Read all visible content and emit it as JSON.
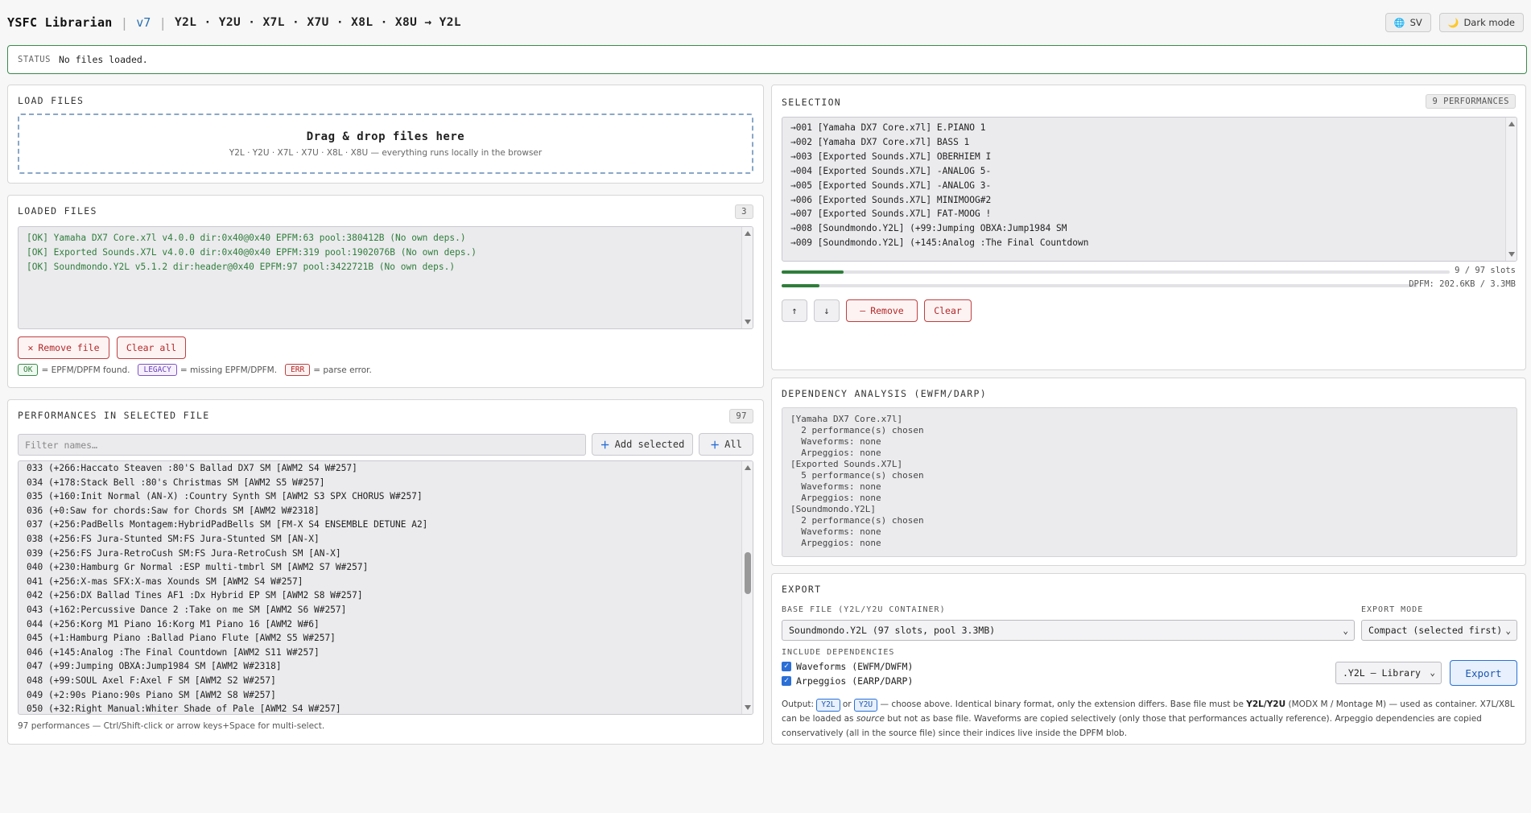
{
  "header": {
    "app_title": "YSFC Librarian",
    "version": "v7",
    "formats": "Y2L · Y2U · X7L · X7U · X8L · X8U → Y2L",
    "lang_label": "SV",
    "theme_label": "Dark mode",
    "lang_icon": "globe-icon",
    "theme_icon": "moon-icon"
  },
  "status": {
    "label": "STATUS",
    "text": "No files loaded."
  },
  "load_files": {
    "title": "LOAD FILES",
    "drop_title": "Drag & drop files here",
    "drop_sub": "Y2L · Y2U · X7L · X7U · X8L · X8U — everything runs locally in the browser"
  },
  "loaded_files": {
    "title": "LOADED FILES",
    "count": "3",
    "lines": [
      "[OK] Yamaha DX7 Core.x7l v4.0.0 dir:0x40@0x40 EPFM:63 pool:380412B (No own deps.)",
      "[OK] Exported Sounds.X7L v4.0.0 dir:0x40@0x40 EPFM:319 pool:1902076B (No own deps.)",
      "[OK] Soundmondo.Y2L v5.1.2 dir:header@0x40 EPFM:97 pool:3422721B (No own deps.)"
    ],
    "remove_label": "Remove file",
    "clear_label": "Clear all",
    "legend": {
      "ok_tag": "OK",
      "ok_text": "= EPFM/DPFM found.",
      "legacy_tag": "LEGACY",
      "legacy_text": "= missing EPFM/DPFM.",
      "err_tag": "ERR",
      "err_text": "= parse error."
    }
  },
  "performances": {
    "title": "PERFORMANCES IN SELECTED FILE",
    "count": "97",
    "filter_placeholder": "Filter names…",
    "add_selected_label": "Add selected",
    "all_label": "All",
    "rows": [
      "033 (+266:Haccato Steaven :80'S Ballad DX7 SM [AWM2 S4 W#257]",
      "034 (+178:Stack Bell :80's Christmas SM [AWM2 S5 W#257]",
      "035 (+160:Init Normal (AN-X) :Country Synth SM [AWM2 S3 SPX CHORUS W#257]",
      "036 (+0:Saw for chords:Saw for Chords SM [AWM2 W#2318]",
      "037 (+256:PadBells Montagem:HybridPadBells SM [FM-X S4 ENSEMBLE DETUNE A2]",
      "038 (+256:FS Jura-Stunted SM:FS Jura-Stunted SM [AN-X]",
      "039 (+256:FS Jura-RetroCush SM:FS Jura-RetroCush SM [AN-X]",
      "040 (+230:Hamburg Gr Normal :ESP multi-tmbrl SM [AWM2 S7 W#257]",
      "041 (+256:X-mas SFX:X-mas Xounds SM [AWM2 S4 W#257]",
      "042 (+256:DX Ballad Tines AF1 :Dx Hybrid EP SM [AWM2 S8 W#257]",
      "043 (+162:Percussive Dance 2 :Take on me SM [AWM2 S6 W#257]",
      "044 (+256:Korg M1 Piano 16:Korg M1 Piano 16 [AWM2 W#6]",
      "045 (+1:Hamburg Piano :Ballad Piano Flute [AWM2 S5 W#257]",
      "046 (+145:Analog :The Final Countdown [AWM2 S11 W#257]",
      "047 (+99:Jumping OBXA:Jump1984 SM [AWM2 W#2318]",
      "048 (+99:SOUL Axel F:Axel F SM [AWM2 S2 W#257]",
      "049 (+2:90s Piano:90s Piano SM [AWM2 S8 W#257]",
      "050 (+32:Right Manual:Whiter Shade of Pale [AWM2 S4 W#257]"
    ],
    "footer": "97 performances — Ctrl/Shift-click or arrow keys+Space for multi-select."
  },
  "selection": {
    "title": "SELECTION",
    "count": "9 PERFORMANCES",
    "rows": [
      "→001 [Yamaha DX7 Core.x7l] E.PIANO 1",
      "→002 [Yamaha DX7 Core.x7l] BASS 1",
      "→003 [Exported Sounds.X7L] OBERHIEM I",
      "→004 [Exported Sounds.X7L] -ANALOG 5-",
      "→005 [Exported Sounds.X7L] -ANALOG 3-",
      "→006 [Exported Sounds.X7L] MINIMOOG#2",
      "→007 [Exported Sounds.X7L] FAT-MOOG !",
      "→008 [Soundmondo.Y2L] (+99:Jumping OBXA:Jump1984 SM",
      "→009 [Soundmondo.Y2L] (+145:Analog :The Final Countdown"
    ],
    "slots_label": "9 / 97 slots",
    "slots_fraction": 0.093,
    "dpfm_label": "DPFM: 202.6KB / 3.3MB",
    "dpfm_fraction": 0.06,
    "up_label": "↑",
    "down_label": "↓",
    "remove_label": "Remove",
    "clear_label": "Clear"
  },
  "dependency": {
    "title": "DEPENDENCY ANALYSIS (EWFM/DARP)",
    "lines": [
      "[Yamaha DX7 Core.x7l]",
      "  2 performance(s) chosen",
      "  Waveforms: none",
      "  Arpeggios: none",
      "[Exported Sounds.X7L]",
      "  5 performance(s) chosen",
      "  Waveforms: none",
      "  Arpeggios: none",
      "[Soundmondo.Y2L]",
      "  2 performance(s) chosen",
      "  Waveforms: none",
      "  Arpeggios: none"
    ]
  },
  "export": {
    "title": "EXPORT",
    "base_label": "BASE FILE (Y2L/Y2U CONTAINER)",
    "base_value": "Soundmondo.Y2L (97 slots, pool 3.3MB)",
    "mode_label": "EXPORT MODE",
    "mode_value": "Compact (selected first)",
    "include_label": "INCLUDE DEPENDENCIES",
    "waveforms_label": "Waveforms (EWFM/DWFM)",
    "arpeggios_label": "Arpeggios (EARP/DARP)",
    "format_value": ".Y2L — Library",
    "export_label": "Export",
    "note": {
      "p1": "Output:",
      "y2l": "Y2L",
      "or": "or",
      "y2u": "Y2U",
      "p2": "— choose above. Identical binary format, only the extension differs. Base file must be",
      "bold": "Y2L/Y2U",
      "p3": "(MODX M / Montage M) — used as container. X7L/X8L can be loaded as",
      "em": "source",
      "p4": "but not as base file. Waveforms are copied selectively (only those that performances actually reference). Arpeggio dependencies are copied conservatively (all in the source file) since their indices live inside the DPFM blob."
    }
  }
}
